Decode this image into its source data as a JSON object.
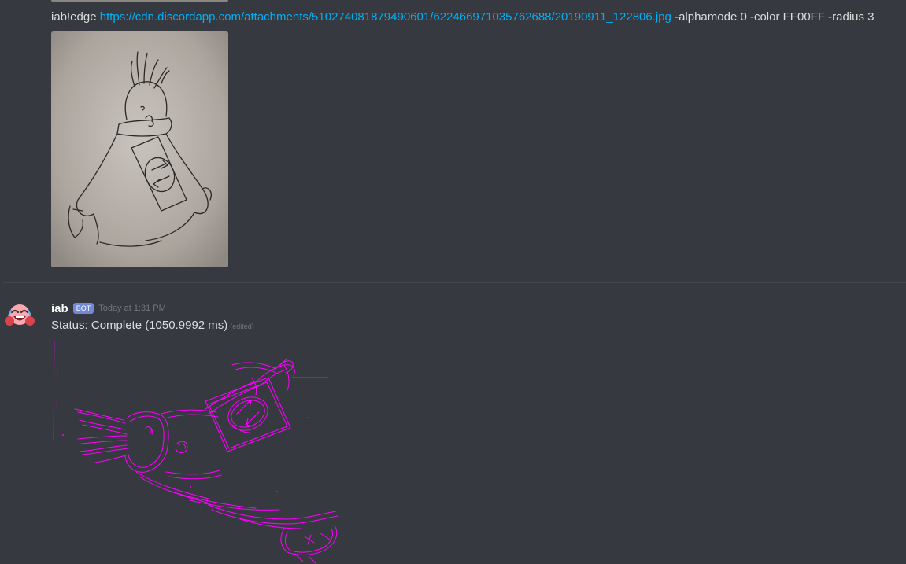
{
  "previous_message": {
    "command": "iab!edge",
    "link": "https://cdn.discordapp.com/attachments/510274081879490601/622466971035762688/20190911_122806.jpg",
    "args": "-alphamode 0 -color FF00FF -radius 3"
  },
  "bot_message": {
    "username": "iab",
    "bot_tag": "BOT",
    "timestamp": "Today at 1:31 PM",
    "status": "Status: Complete (1050.9992 ms)",
    "edited": "(edited)"
  },
  "colors": {
    "background": "#36393f",
    "link": "#00b0f4",
    "bot_tag": "#7289da",
    "edge_color": "#FF00FF"
  },
  "icons": {
    "avatar": "laughing-face-avatar"
  }
}
